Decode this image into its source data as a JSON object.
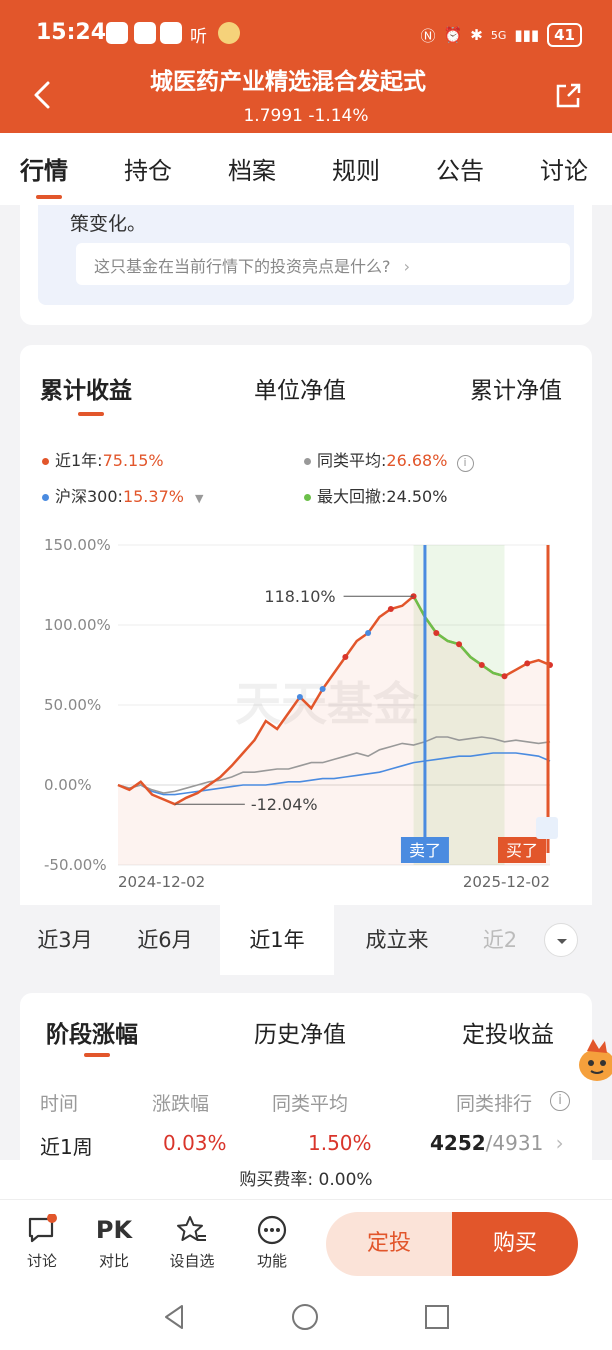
{
  "status": {
    "time": "15:24",
    "listen": "听",
    "signal": "5G",
    "battery": "41"
  },
  "header": {
    "title": "城医药产业精选混合发起式",
    "subtitle": "1.7991 -1.14%"
  },
  "tabs": [
    "行情",
    "持仓",
    "档案",
    "规则",
    "公告",
    "讨论"
  ],
  "ai": {
    "tail_text": "策变化。",
    "question": "这只基金在当前行情下的投资亮点是什么?"
  },
  "chart_tabs": [
    "累计收益",
    "单位净值",
    "累计净值"
  ],
  "legend": {
    "fund": {
      "label": "近1年:",
      "value": "75.15%",
      "color": "#e2562b"
    },
    "category_avg": {
      "label": "同类平均:",
      "value": "26.68%",
      "color": "#999999"
    },
    "hs300": {
      "label": "沪深300:",
      "value": "15.37%",
      "color": "#4a8be0"
    },
    "max_drawdown": {
      "label": "最大回撤:",
      "value": "24.50%",
      "color": "#6cc04a"
    }
  },
  "chart_data": {
    "type": "line",
    "y_ticks": [
      "150.00%",
      "100.00%",
      "50.00%",
      "0.00%",
      "-50.00%"
    ],
    "ylim": [
      -50,
      150
    ],
    "x_ticks": [
      "2024-12-02",
      "2025-12-02"
    ],
    "annotations": {
      "peak": "118.10%",
      "trough": "-12.04%",
      "sell": "卖了",
      "buy": "买了"
    },
    "watermark": "天天基金",
    "series": [
      {
        "name": "近1年",
        "color": "#e2562b",
        "values": [
          0,
          -3,
          2,
          -6,
          -9,
          -12,
          -8,
          -5,
          0,
          5,
          12,
          20,
          28,
          40,
          35,
          45,
          55,
          48,
          60,
          70,
          80,
          90,
          95,
          105,
          110,
          112,
          118,
          105,
          95,
          90,
          88,
          80,
          75,
          70,
          68,
          72,
          76,
          78,
          75
        ]
      },
      {
        "name": "同类平均",
        "color": "#999999",
        "values": [
          0,
          -2,
          0,
          -3,
          -5,
          -4,
          -2,
          0,
          2,
          3,
          5,
          8,
          8,
          9,
          10,
          10,
          12,
          14,
          14,
          16,
          18,
          20,
          18,
          22,
          24,
          26,
          25,
          27,
          30,
          30,
          28,
          29,
          30,
          29,
          27,
          28,
          27,
          26,
          27
        ]
      },
      {
        "name": "沪深300",
        "color": "#4a8be0",
        "values": [
          0,
          -2,
          0,
          -4,
          -6,
          -6,
          -5,
          -4,
          -3,
          -2,
          -1,
          0,
          0,
          0,
          1,
          2,
          2,
          3,
          4,
          4,
          5,
          6,
          7,
          8,
          10,
          12,
          14,
          15,
          16,
          17,
          18,
          18,
          19,
          20,
          20,
          20,
          19,
          18,
          15
        ]
      }
    ]
  },
  "periods": [
    "近3月",
    "近6月",
    "近1年",
    "成立来",
    "近2"
  ],
  "stage_tabs": [
    "阶段涨幅",
    "历史净值",
    "定投收益"
  ],
  "stage_table": {
    "headers": [
      "时间",
      "涨跌幅",
      "同类平均",
      "同类排行"
    ],
    "row": {
      "period": "近1周",
      "change": "0.03%",
      "avg": "1.50%",
      "rank": "4252",
      "total": "/4931"
    }
  },
  "fee": "购买费率: 0.00%",
  "bottom": {
    "discuss": "讨论",
    "pk": "PK",
    "compare": "对比",
    "watchlist": "设自选",
    "func": "功能",
    "dingtou": "定投",
    "buy": "购买"
  },
  "colors": {
    "brand": "#e2562b",
    "up": "#d9352b",
    "drawdown": "#6cc04a"
  }
}
